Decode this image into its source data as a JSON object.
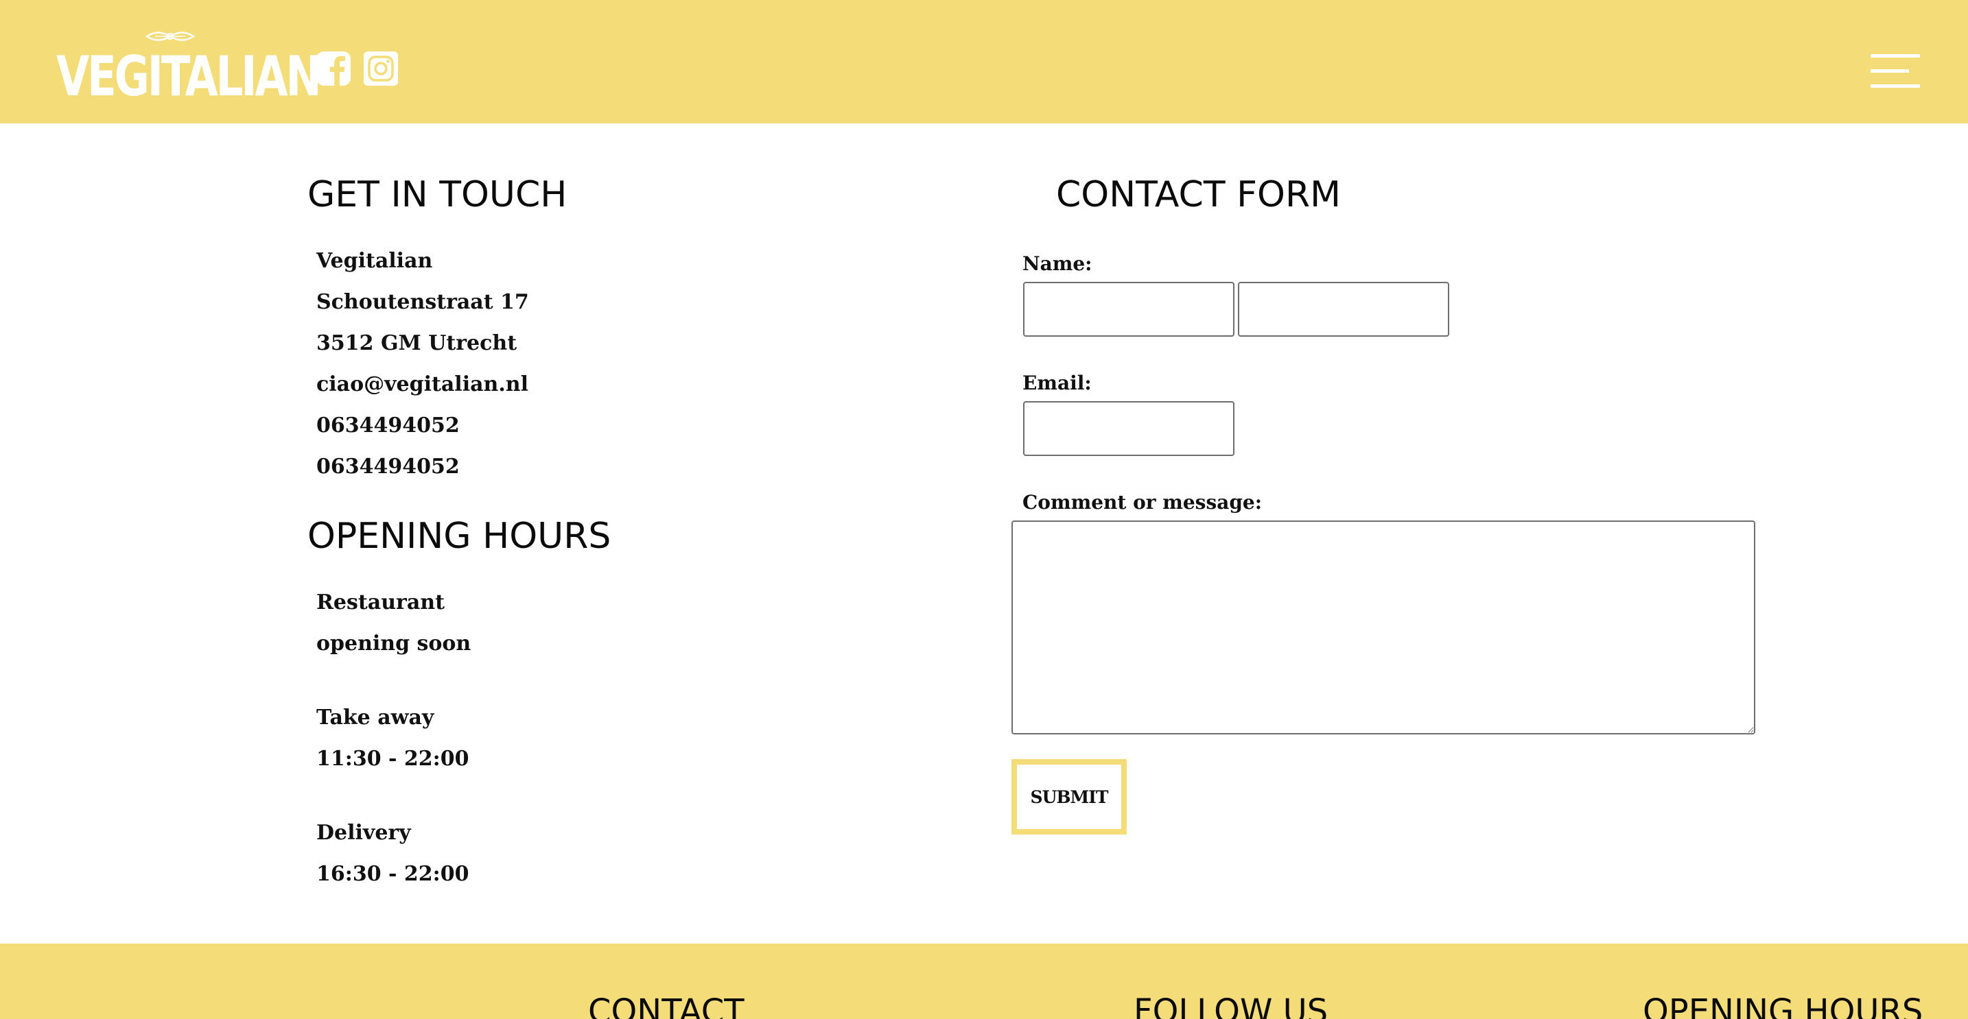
{
  "header": {
    "logo_text": "VEGITALIAN",
    "social": [
      {
        "name": "facebook",
        "icon": "facebook-icon"
      },
      {
        "name": "instagram",
        "icon": "instagram-icon"
      }
    ],
    "menu_icon": "hamburger-menu-icon"
  },
  "contact_info": {
    "title": "GET IN TOUCH",
    "lines": [
      "Vegitalian",
      "Schoutenstraat 17",
      "3512 GM Utrecht",
      "ciao@vegitalian.nl",
      "0634494052",
      "0634494052"
    ]
  },
  "opening_hours": {
    "title": "OPENING HOURS",
    "entries": [
      {
        "label": "Restaurant",
        "hours": "opening soon"
      },
      {
        "label": "Take away",
        "hours": "11:30 - 22:00"
      },
      {
        "label": "Delivery",
        "hours": "16:30 - 22:00"
      }
    ]
  },
  "contact_form": {
    "title": "CONTACT FORM",
    "name_label": "Name:",
    "first_name_value": "",
    "last_name_value": "",
    "email_label": "Email:",
    "email_value": "",
    "message_label": "Comment or message:",
    "message_value": "",
    "submit_label": "SUBMIT"
  },
  "footer": {
    "headings": [
      "CONTACT",
      "FOLLOW US",
      "OPENING HOURS"
    ]
  },
  "colors": {
    "brand_yellow": "#f4dd78",
    "text": "#111111",
    "white": "#ffffff"
  }
}
